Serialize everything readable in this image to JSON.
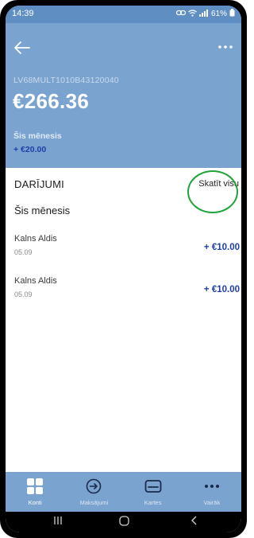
{
  "status": {
    "time": "14:39",
    "right": "61%"
  },
  "account": {
    "iban": "LV68MULT1010B43120040",
    "balance": "€266.36",
    "month_label": "Šis mēnesis",
    "month_amount": "+ €20.00"
  },
  "transactions": {
    "title": "DARĪJUMI",
    "see_all": "Skatīt visu",
    "period": "Šis mēnesis",
    "items": [
      {
        "name": "Kalns Aldis",
        "date": "05.09",
        "amount": "+ €10.00"
      },
      {
        "name": "Kalns Aldis",
        "date": "05.09",
        "amount": "+ €10.00"
      }
    ]
  },
  "nav": {
    "items": [
      {
        "label": "Konti",
        "icon": "grid-icon"
      },
      {
        "label": "Maksājumi",
        "icon": "transfer-icon"
      },
      {
        "label": "Kartes",
        "icon": "card-icon"
      },
      {
        "label": "Vairāk",
        "icon": "more-icon"
      }
    ]
  },
  "colors": {
    "header": "#7ba3cf",
    "accent_amount": "#1f3fa8",
    "highlight": "#21a33a"
  }
}
